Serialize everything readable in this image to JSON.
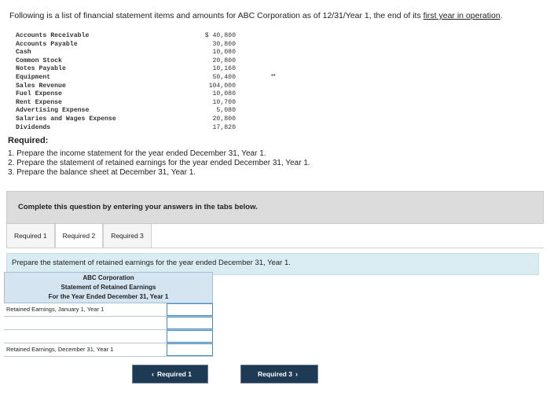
{
  "intro": {
    "text": "Following is a list of financial statement items and amounts for ABC Corporation as of 12/31/Year 1, the end of its ",
    "underlined": "first year in operation",
    "period": "."
  },
  "items": [
    {
      "name": "Accounts Receivable",
      "value": "$ 40,800"
    },
    {
      "name": "Accounts Payable",
      "value": "30,800"
    },
    {
      "name": "Cash",
      "value": "10,080"
    },
    {
      "name": "Common Stock",
      "value": "20,800"
    },
    {
      "name": "Notes Payable",
      "value": "10,160"
    },
    {
      "name": "Equipment",
      "value": "50,400"
    },
    {
      "name": "Sales Revenue",
      "value": "104,000"
    },
    {
      "name": "Fuel Expense",
      "value": "10,080"
    },
    {
      "name": "Rent Expense",
      "value": "10,700"
    },
    {
      "name": "Advertising Expense",
      "value": "5,080"
    },
    {
      "name": "Salaries and Wages Expense",
      "value": "20,800"
    },
    {
      "name": "Dividends",
      "value": "17,820"
    }
  ],
  "mark": "▪•",
  "required": {
    "heading": "Required:",
    "list": [
      "1. Prepare the income statement for the year ended December 31, Year 1.",
      "2. Prepare the statement of retained earnings for the year ended December 31, Year 1.",
      "3. Prepare the balance sheet at December 31, Year 1."
    ]
  },
  "instruction": "Complete this question by entering your answers in the tabs below.",
  "tabs": [
    "Required 1",
    "Required 2",
    "Required 3"
  ],
  "active_tab": 1,
  "prompt": "Prepare the statement of retained earnings for the year ended December 31, Year 1.",
  "statement": {
    "company": "ABC Corporation",
    "title": "Statement of Retained Earnings",
    "period": "For the Year Ended December 31, Year 1",
    "row_begin": "Retained Earnings, January 1, Year 1",
    "row_end": "Retained Earnings, December 31, Year 1"
  },
  "nav": {
    "prev_label": "Required 1",
    "next_label": "Required 3",
    "prev_glyph": "‹",
    "next_glyph": "›",
    "button_color": "#1e3a55"
  }
}
